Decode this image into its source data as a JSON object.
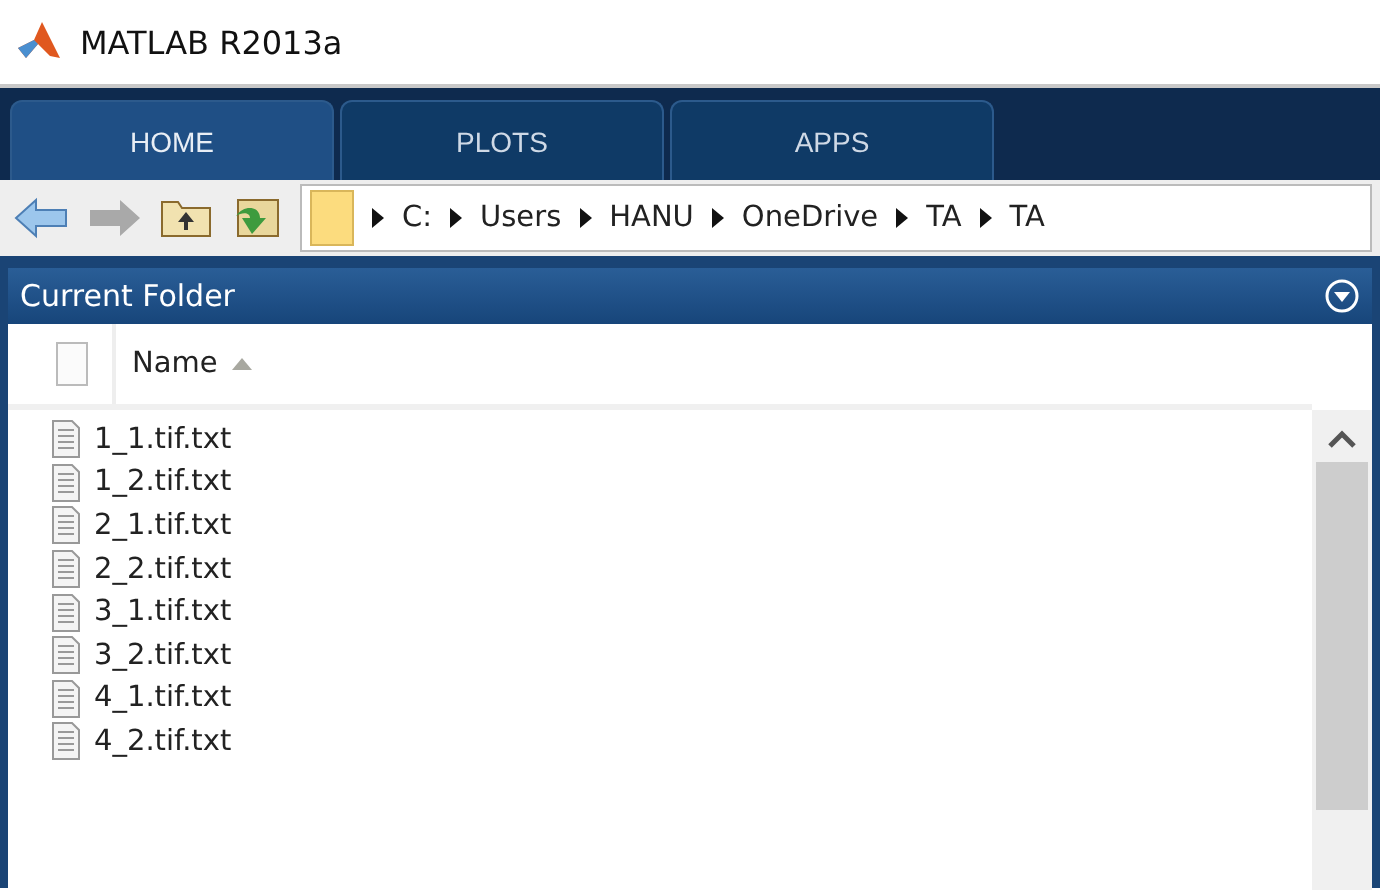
{
  "window": {
    "title": "MATLAB R2013a"
  },
  "tabs": [
    {
      "label": "HOME",
      "selected": true
    },
    {
      "label": "PLOTS",
      "selected": false
    },
    {
      "label": "APPS",
      "selected": false
    }
  ],
  "address": {
    "path": [
      "C:",
      "Users",
      "HANU",
      "OneDrive",
      "TA",
      "TA"
    ]
  },
  "panel": {
    "title": "Current Folder"
  },
  "table": {
    "columns": [
      {
        "label": "Name",
        "sorted": true
      }
    ],
    "rows": [
      "1_1.tif.txt",
      "1_2.tif.txt",
      "2_1.tif.txt",
      "2_2.tif.txt",
      "3_1.tif.txt",
      "3_2.tif.txt",
      "4_1.tif.txt",
      "4_2.tif.txt"
    ]
  }
}
